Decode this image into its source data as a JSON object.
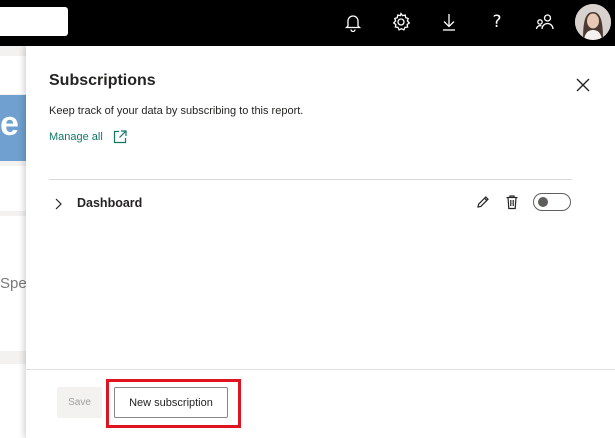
{
  "topbar": {
    "icons": [
      "bell-icon",
      "gear-icon",
      "download-icon",
      "help-icon",
      "share-people-icon"
    ],
    "help_glyph": "?"
  },
  "background": {
    "partial_letter": "e",
    "partial_text": "Spe"
  },
  "panel": {
    "title": "Subscriptions",
    "description": "Keep track of your data by subscribing to this report.",
    "manage_all_label": "Manage all",
    "subscriptions": [
      {
        "name": "Dashboard",
        "enabled": false
      }
    ],
    "buttons": {
      "save_label": "Save",
      "new_subscription_label": "New subscription"
    }
  },
  "colors": {
    "accent_link": "#117865",
    "highlight": "#e0141e",
    "topbar": "#000000"
  }
}
